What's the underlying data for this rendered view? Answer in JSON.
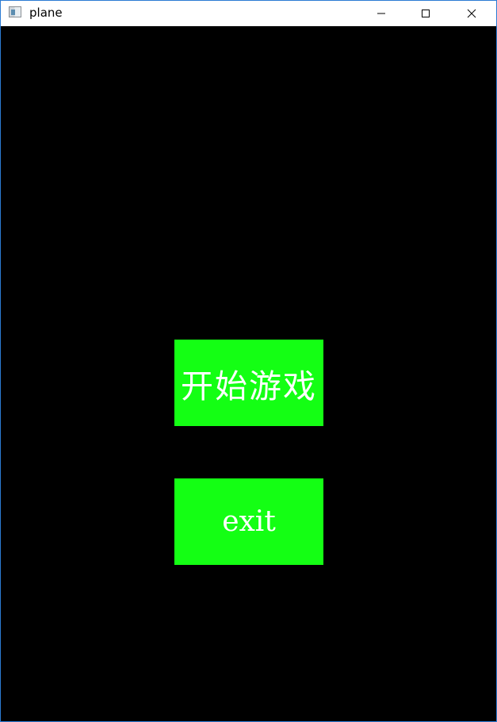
{
  "window": {
    "title": "plane",
    "icon": "app-window-icon",
    "controls": [
      "minimize-icon",
      "maximize-icon",
      "close-icon"
    ]
  },
  "menu": {
    "start_label": "开始游戏",
    "exit_label": "exit"
  },
  "colors": {
    "background": "#000000",
    "button": "#14ff14",
    "button_text": "#ffffff",
    "window_border": "#2b7bd3"
  }
}
